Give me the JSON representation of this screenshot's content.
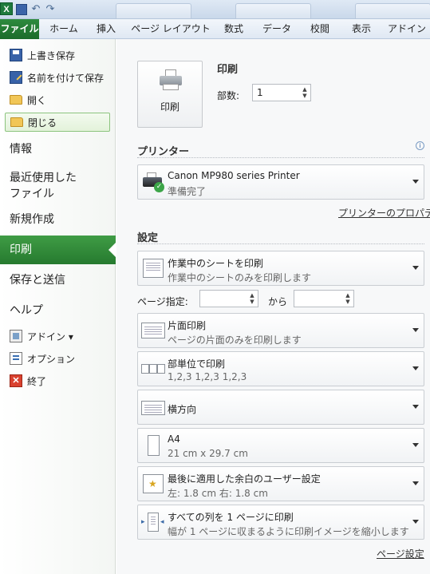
{
  "tabs": {
    "file": "ファイル",
    "home": "ホーム",
    "insert": "挿入",
    "page_layout": "ページ レイアウト",
    "formulas": "数式",
    "data": "データ",
    "review": "校閲",
    "view": "表示",
    "addin": "アドイン"
  },
  "left_pane": {
    "save": "上書き保存",
    "save_as": "名前を付けて保存",
    "open": "開く",
    "close": "閉じる",
    "info": "情報",
    "recent_line1": "最近使用した",
    "recent_line2": "ファイル",
    "new": "新規作成",
    "print": "印刷",
    "save_send": "保存と送信",
    "help": "ヘルプ",
    "addins": "アドイン ▾",
    "options": "オプション",
    "exit": "終了"
  },
  "print_section": {
    "header": "印刷",
    "print_button": "印刷",
    "copies_label": "部数:",
    "copies_value": "1"
  },
  "printer": {
    "header": "プリンター",
    "name": "Canon MP980 series Printer",
    "status": "準備完了",
    "properties_link": "プリンターのプロパティ"
  },
  "settings": {
    "header": "設定",
    "what": {
      "title": "作業中のシートを印刷",
      "desc": "作業中のシートのみを印刷します"
    },
    "pages_label": "ページ指定:",
    "pages_to": "から",
    "sides": {
      "title": "片面印刷",
      "desc": "ページの片面のみを印刷します"
    },
    "collate": {
      "title": "部単位で印刷",
      "desc": "1,2,3    1,2,3    1,2,3"
    },
    "orientation": {
      "title": "横方向"
    },
    "paper": {
      "title": "A4",
      "desc": "21 cm x 29.7 cm"
    },
    "margins": {
      "title": "最後に適用した余白のユーザー設定",
      "desc": "左:  1.8 cm    右:  1.8 cm"
    },
    "scaling": {
      "title": "すべての列を 1 ページに印刷",
      "desc": "幅が 1 ページに収まるように印刷イメージを縮小します"
    },
    "page_setup_link": "ページ設定"
  },
  "colors": {
    "file_tab": "#1b6b2a",
    "print_selected": "#3f9c45",
    "close_highlight": "#8cc47e"
  }
}
